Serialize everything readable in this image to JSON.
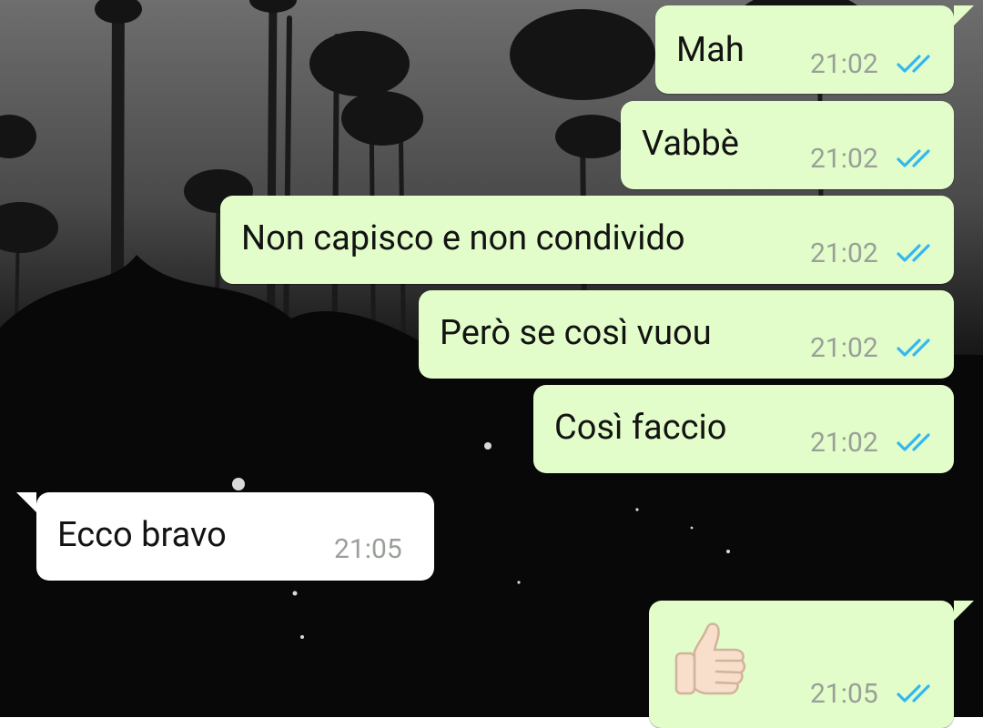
{
  "messages": [
    {
      "text": "Mah",
      "time": "21:02",
      "direction": "outgoing",
      "status": "read-double-check",
      "tail": true
    },
    {
      "text": "Vabbè",
      "time": "21:02",
      "direction": "outgoing",
      "status": "read-double-check",
      "tail": false
    },
    {
      "text": "Non capisco e non condivido",
      "time": "21:02",
      "direction": "outgoing",
      "status": "read-double-check",
      "tail": false
    },
    {
      "text": "Però se così vuou",
      "time": "21:02",
      "direction": "outgoing",
      "status": "read-double-check",
      "tail": false
    },
    {
      "text": "Così faccio",
      "time": "21:02",
      "direction": "outgoing",
      "status": "read-double-check",
      "tail": false
    },
    {
      "text": "Ecco bravo",
      "time": "21:05",
      "direction": "incoming",
      "status": "",
      "tail": true
    },
    {
      "emoji": "thumbs-up-icon",
      "time": "21:05",
      "direction": "outgoing",
      "status": "read-double-check",
      "tail": true
    }
  ],
  "colors": {
    "outgoing_bubble": "#e2fdc9",
    "incoming_bubble": "#ffffff",
    "read_ticks": "#34b7f1",
    "timestamp": "#9a9f9a",
    "message_text": "#131313"
  },
  "icons": {
    "read_receipt": "double-check-icon",
    "emoji": "thumbs-up-icon",
    "wallpaper": "palm-trees-night-wallpaper"
  }
}
